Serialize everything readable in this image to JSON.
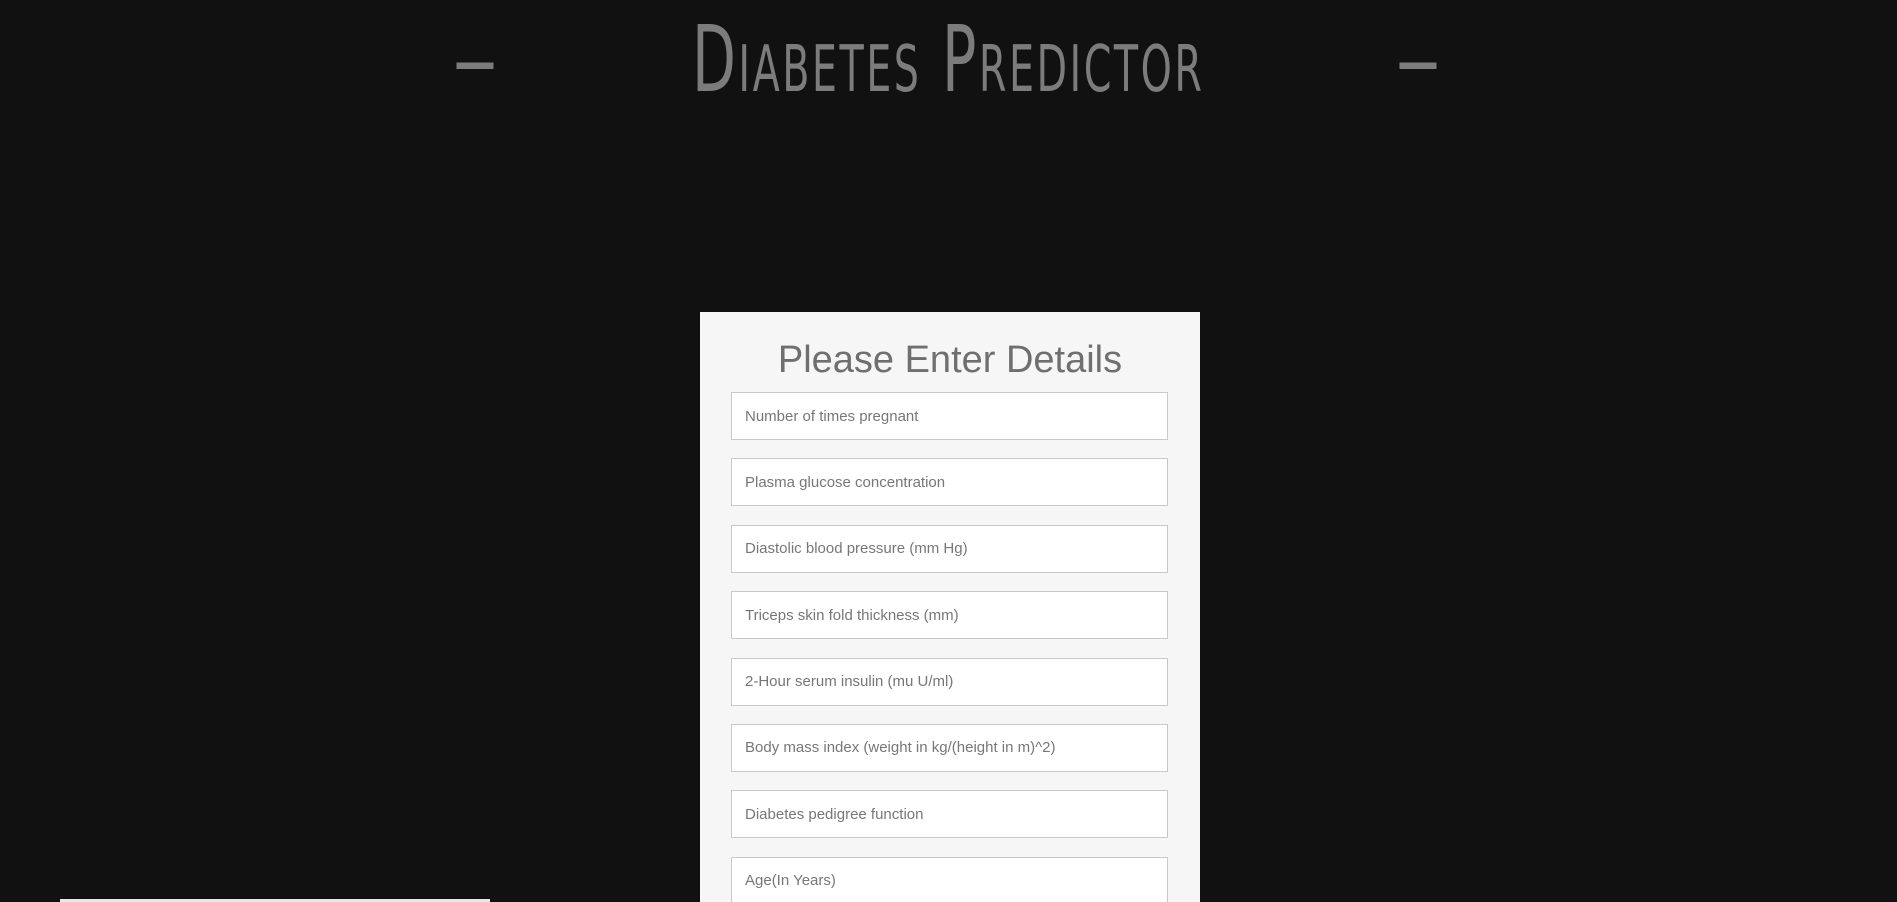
{
  "header": {
    "title": "Diabetes Predictor",
    "left_dash": "–",
    "right_dash": "–"
  },
  "form": {
    "heading": "Please Enter Details",
    "fields": [
      {
        "placeholder": "Number of times pregnant",
        "value": ""
      },
      {
        "placeholder": "Plasma glucose concentration",
        "value": ""
      },
      {
        "placeholder": "Diastolic blood pressure (mm Hg)",
        "value": ""
      },
      {
        "placeholder": "Triceps skin fold thickness (mm)",
        "value": ""
      },
      {
        "placeholder": "2-Hour serum insulin (mu U/ml)",
        "value": ""
      },
      {
        "placeholder": "Body mass index (weight in kg/(height in m)^2)",
        "value": ""
      },
      {
        "placeholder": "Diabetes pedigree function",
        "value": ""
      },
      {
        "placeholder": "Age(In Years)",
        "value": ""
      }
    ]
  },
  "colors": {
    "background": "#111111",
    "title": "#7c7c7c",
    "card": "#f6f6f6",
    "heading": "#6f6f6f",
    "field_border": "#c9c9c9"
  }
}
